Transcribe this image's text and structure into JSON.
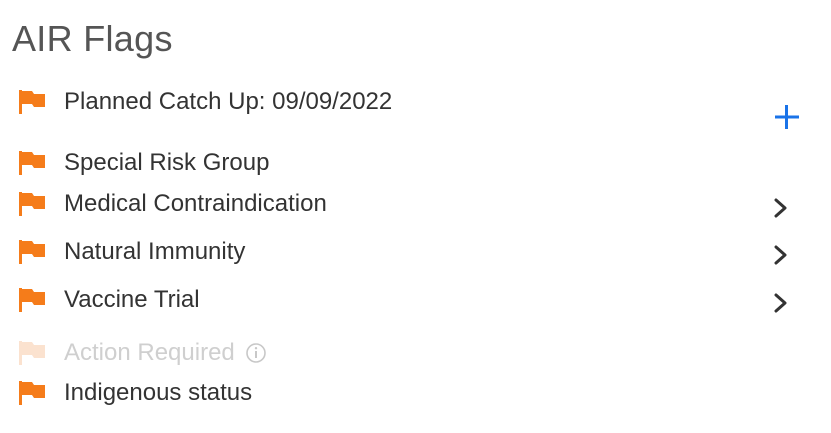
{
  "panel": {
    "title": "AIR Flags",
    "add_icon": "plus-icon",
    "accent_color": "#f57c1a",
    "disabled_color": "#fbe2cf",
    "link_color": "#1a73e8",
    "flags": [
      {
        "label": "Planned Catch Up: 09/09/2022",
        "icon": "flag-icon",
        "enabled": true
      },
      {
        "label": "Special Risk Group",
        "icon": "flag-icon",
        "enabled": true
      },
      {
        "label": "Medical Contraindication",
        "icon": "flag-icon",
        "enabled": true,
        "expandable": true
      },
      {
        "label": "Natural Immunity",
        "icon": "flag-icon",
        "enabled": true,
        "expandable": true
      },
      {
        "label": "Vaccine Trial",
        "icon": "flag-icon",
        "enabled": true,
        "expandable": true
      },
      {
        "label": "Action Required",
        "icon": "flag-icon",
        "enabled": false,
        "info_icon": "info-icon"
      },
      {
        "label": "Indigenous status",
        "icon": "flag-icon",
        "enabled": true
      }
    ]
  }
}
